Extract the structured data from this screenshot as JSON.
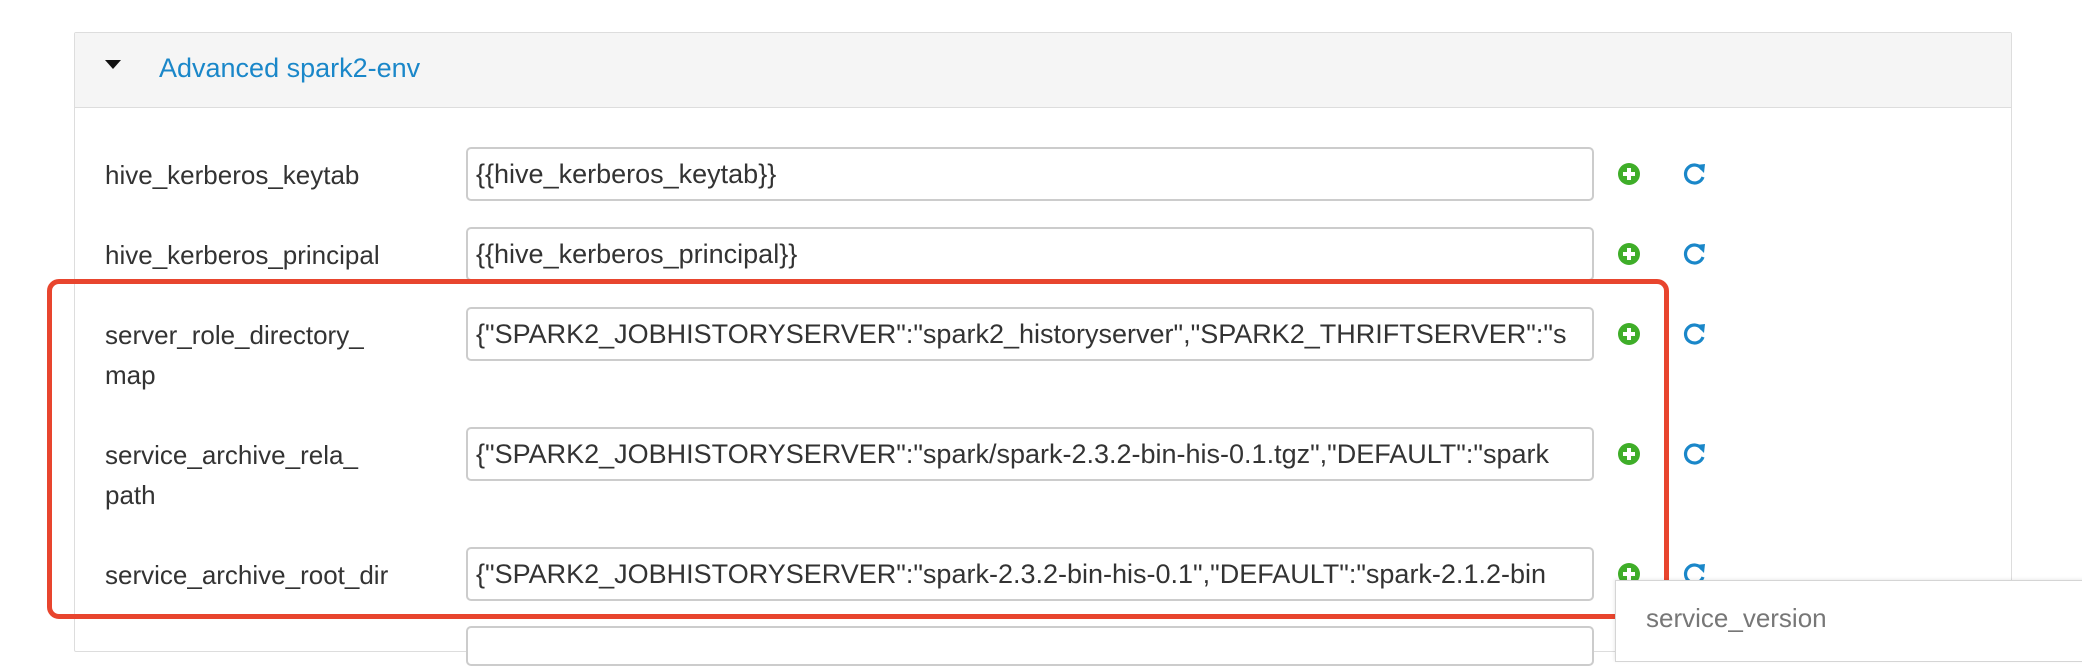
{
  "section": {
    "title": "Advanced spark2-env",
    "expanded": true,
    "accent_color": "#1a87c9"
  },
  "rows": [
    {
      "label": "hive_kerberos_keytab",
      "value": "{{hive_kerberos_keytab}}"
    },
    {
      "label": "hive_kerberos_principal",
      "value": "{{hive_kerberos_principal}}"
    },
    {
      "label": "server_role_directory_\nmap",
      "value": "{\"SPARK2_JOBHISTORYSERVER\":\"spark2_historyserver\",\"SPARK2_THRIFTSERVER\":\"s"
    },
    {
      "label": "service_archive_rela_\npath",
      "value": "{\"SPARK2_JOBHISTORYSERVER\":\"spark/spark-2.3.2-bin-his-0.1.tgz\",\"DEFAULT\":\"spark"
    },
    {
      "label": "service_archive_root_dir",
      "value": "{\"SPARK2_JOBHISTORYSERVER\":\"spark-2.3.2-bin-his-0.1\",\"DEFAULT\":\"spark-2.1.2-bin"
    }
  ],
  "icons": {
    "add": "plus-circle-icon",
    "refresh": "refresh-icon",
    "add_color": "#3fae29",
    "refresh_color": "#1a87c9"
  },
  "annotation": {
    "color": "#e8452e"
  },
  "popup": {
    "label": "service_version"
  }
}
